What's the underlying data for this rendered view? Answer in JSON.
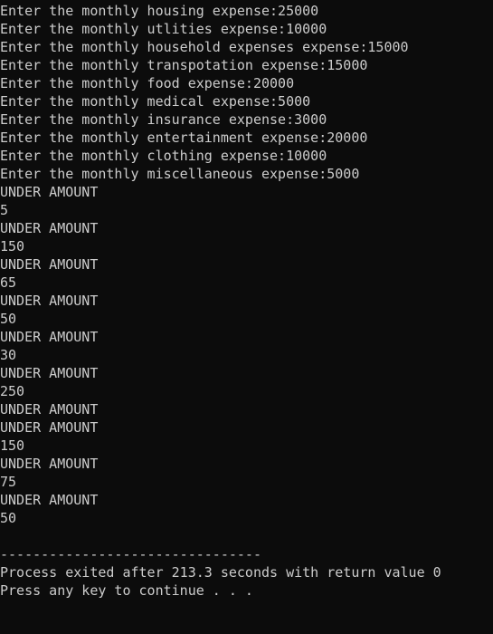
{
  "console": {
    "lines": [
      "Enter the monthly housing expense:25000",
      "Enter the monthly utlities expense:10000",
      "Enter the monthly household expenses expense:15000",
      "Enter the monthly transpotation expense:15000",
      "Enter the monthly food expense:20000",
      "Enter the monthly medical expense:5000",
      "Enter the monthly insurance expense:3000",
      "Enter the monthly entertainment expense:20000",
      "Enter the monthly clothing expense:10000",
      "Enter the monthly miscellaneous expense:5000",
      "UNDER AMOUNT",
      "5",
      "UNDER AMOUNT",
      "150",
      "UNDER AMOUNT",
      "65",
      "UNDER AMOUNT",
      "50",
      "UNDER AMOUNT",
      "30",
      "UNDER AMOUNT",
      "250",
      "UNDER AMOUNT",
      "UNDER AMOUNT",
      "150",
      "UNDER AMOUNT",
      "75",
      "UNDER AMOUNT",
      "50",
      "",
      "--------------------------------",
      "Process exited after 213.3 seconds with return value 0",
      "Press any key to continue . . ."
    ]
  },
  "colors": {
    "background": "#0c0c0c",
    "text": "#cccccc"
  }
}
